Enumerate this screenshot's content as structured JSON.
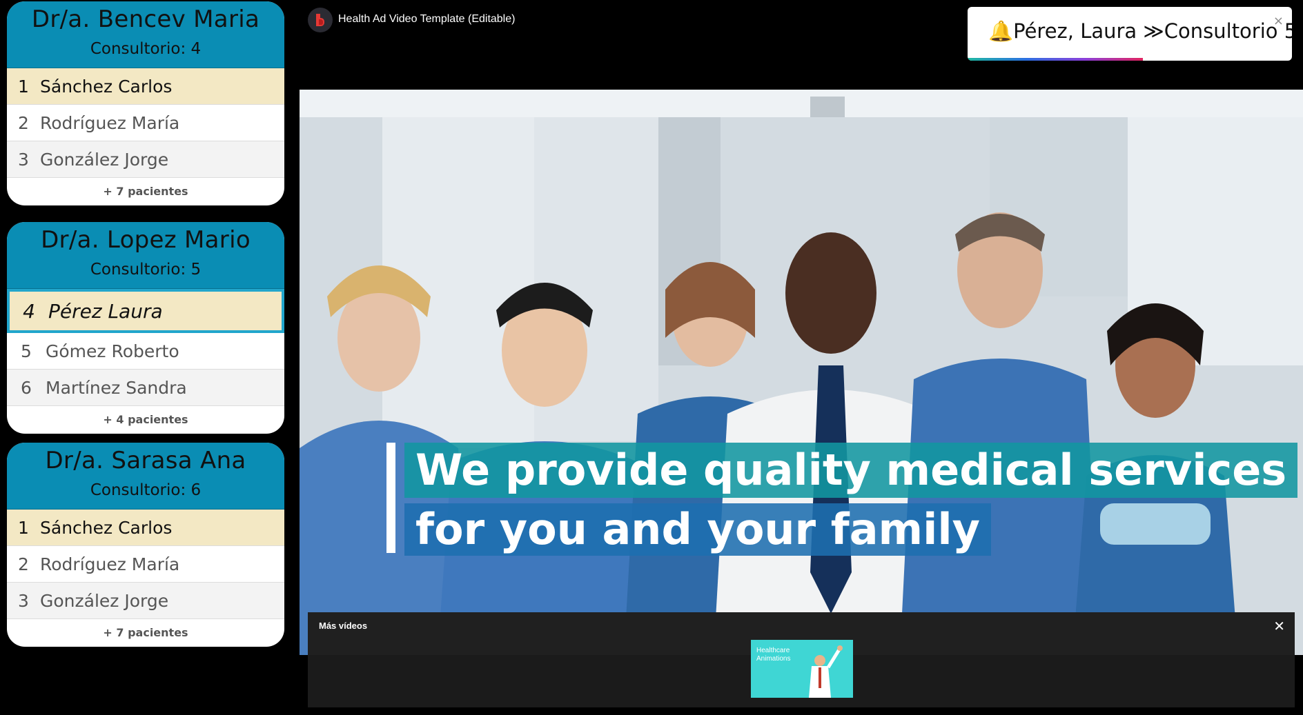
{
  "queues": [
    {
      "doctor": "Dr/a. Bencev Maria",
      "room": "Consultorio: 4",
      "patients": [
        {
          "num": "1",
          "name": "Sánchez Carlos"
        },
        {
          "num": "2",
          "name": "Rodríguez María"
        },
        {
          "num": "3",
          "name": "González Jorge"
        }
      ],
      "more": "+ 7 pacientes"
    },
    {
      "doctor": "Dr/a. Lopez Mario",
      "room": "Consultorio: 5",
      "patients": [
        {
          "num": "4",
          "name": "Pérez Laura"
        },
        {
          "num": "5",
          "name": "Gómez Roberto"
        },
        {
          "num": "6",
          "name": "Martínez Sandra"
        }
      ],
      "more": "+ 4 pacientes"
    },
    {
      "doctor": "Dr/a. Sarasa Ana",
      "room": "Consultorio: 6",
      "patients": [
        {
          "num": "1",
          "name": "Sánchez Carlos"
        },
        {
          "num": "2",
          "name": "Rodríguez María"
        },
        {
          "num": "3",
          "name": "González Jorge"
        }
      ],
      "more": "+ 7 pacientes"
    }
  ],
  "video": {
    "title": "Health Ad Video Template (Editable)",
    "caption_line1": "We provide quality medical services",
    "caption_line2": "for you and your family",
    "more_videos_label": "Más vídeos",
    "thumb_text": "Healthcare Animations",
    "close_symbol": "✕"
  },
  "notification": {
    "icon": "bell-icon",
    "text": "Pérez, Laura ≫Consultorio 5",
    "close_symbol": "×",
    "progress": 0.54
  },
  "colors": {
    "header": "#0a8db4",
    "active_row": "#f3e8c4",
    "selected_border": "#22a6cc"
  }
}
